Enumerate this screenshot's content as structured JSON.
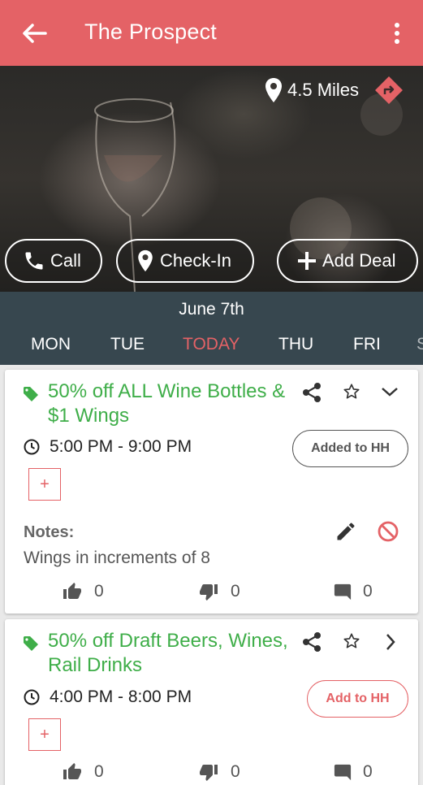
{
  "appbar": {
    "title": "The Prospect"
  },
  "hero": {
    "distance": "4.5 Miles"
  },
  "actions": {
    "call": "Call",
    "checkin": "Check-In",
    "add_deal": "Add Deal"
  },
  "daybar": {
    "date": "June 7th",
    "days": [
      "MON",
      "TUE",
      "TODAY",
      "THU",
      "FRI",
      "S"
    ],
    "active_index": 2
  },
  "deals": [
    {
      "title": "50% off ALL Wine Bottles & $1 Wings",
      "time": "5:00 PM - 9:00 PM",
      "hh_label": "Added to HH",
      "plus": "+",
      "notes_label": "Notes:",
      "notes": "Wings in increments of 8",
      "likes": "0",
      "dislikes": "0",
      "comments": "0"
    },
    {
      "title": "50% off Draft Beers, Wines, Rail Drinks",
      "time": "4:00 PM - 8:00 PM",
      "hh_label": "Add to HH",
      "plus": "+",
      "likes": "0",
      "dislikes": "0",
      "comments": "0"
    }
  ],
  "colors": {
    "accent": "#e46266",
    "green": "#3fae49",
    "daybar": "#37474f"
  },
  "icons": [
    "back-arrow-icon",
    "more-vert-icon",
    "location-pin-icon",
    "directions-icon",
    "phone-icon",
    "plus-icon",
    "tag-icon",
    "share-icon",
    "star-icon",
    "chevron-down-icon",
    "chevron-right-icon",
    "clock-icon",
    "pencil-icon",
    "block-icon",
    "thumbs-up-icon",
    "thumbs-down-icon",
    "comment-icon"
  ]
}
